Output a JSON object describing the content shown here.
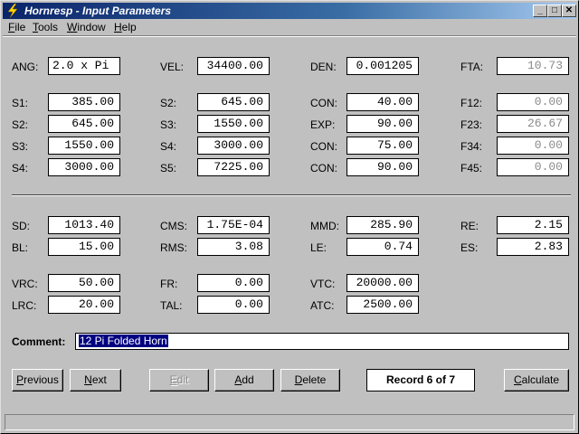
{
  "window": {
    "title": "Hornresp - Input Parameters"
  },
  "titlebar_buttons": {
    "minimize": "_",
    "maximize": "□",
    "close": "✕"
  },
  "menu": [
    {
      "accel": "F",
      "rest": "ile"
    },
    {
      "accel": "T",
      "rest": "ools"
    },
    {
      "accel": "W",
      "rest": "indow"
    },
    {
      "accel": "H",
      "rest": "elp"
    }
  ],
  "horn": {
    "ang": {
      "label": "ANG:",
      "value": "2.0 x Pi"
    },
    "vel": {
      "label": "VEL:",
      "value": "34400.00"
    },
    "den": {
      "label": "DEN:",
      "value": "0.001205"
    },
    "fta": {
      "label": "FTA:",
      "value": "10.73"
    },
    "col1": [
      {
        "label": "S1:",
        "value": "385.00"
      },
      {
        "label": "S2:",
        "value": "645.00"
      },
      {
        "label": "S3:",
        "value": "1550.00"
      },
      {
        "label": "S4:",
        "value": "3000.00"
      }
    ],
    "col2": [
      {
        "label": "S2:",
        "value": "645.00"
      },
      {
        "label": "S3:",
        "value": "1550.00"
      },
      {
        "label": "S4:",
        "value": "3000.00"
      },
      {
        "label": "S5:",
        "value": "7225.00"
      }
    ],
    "col3": [
      {
        "label": "CON:",
        "value": "40.00"
      },
      {
        "label": "EXP:",
        "value": "90.00"
      },
      {
        "label": "CON:",
        "value": "75.00"
      },
      {
        "label": "CON:",
        "value": "90.00"
      }
    ],
    "col4": [
      {
        "label": "F12:",
        "value": "0.00"
      },
      {
        "label": "F23:",
        "value": "26.67"
      },
      {
        "label": "F34:",
        "value": "0.00"
      },
      {
        "label": "F45:",
        "value": "0.00"
      }
    ]
  },
  "driver": {
    "sd": {
      "label": "SD:",
      "value": "1013.40"
    },
    "cms": {
      "label": "CMS:",
      "value": "1.75E-04"
    },
    "mmd": {
      "label": "MMD:",
      "value": "285.90"
    },
    "re": {
      "label": "RE:",
      "value": "2.15"
    },
    "bl": {
      "label": "BL:",
      "value": "15.00"
    },
    "rms": {
      "label": "RMS:",
      "value": "3.08"
    },
    "le": {
      "label": "LE:",
      "value": "0.74"
    },
    "es": {
      "label": "ES:",
      "value": "2.83"
    }
  },
  "chambers": {
    "vrc": {
      "label": "VRC:",
      "value": "50.00"
    },
    "fr": {
      "label": "FR:",
      "value": "0.00"
    },
    "vtc": {
      "label": "VTC:",
      "value": "20000.00"
    },
    "lrc": {
      "label": "LRC:",
      "value": "20.00"
    },
    "tal": {
      "label": "TAL:",
      "value": "0.00"
    },
    "atc": {
      "label": "ATC:",
      "value": "2500.00"
    }
  },
  "comment": {
    "label": "Comment:",
    "value": "12 Pi Folded Horn"
  },
  "buttons": {
    "previous": {
      "accel": "P",
      "rest": "revious"
    },
    "next": {
      "accel": "N",
      "rest": "ext"
    },
    "edit": {
      "accel": "E",
      "rest": "dit"
    },
    "add": {
      "accel": "A",
      "rest": "dd"
    },
    "delete": {
      "accel": "D",
      "rest": "elete"
    },
    "calculate": {
      "accel": "C",
      "rest": "alculate"
    }
  },
  "record": "Record 6 of 7"
}
